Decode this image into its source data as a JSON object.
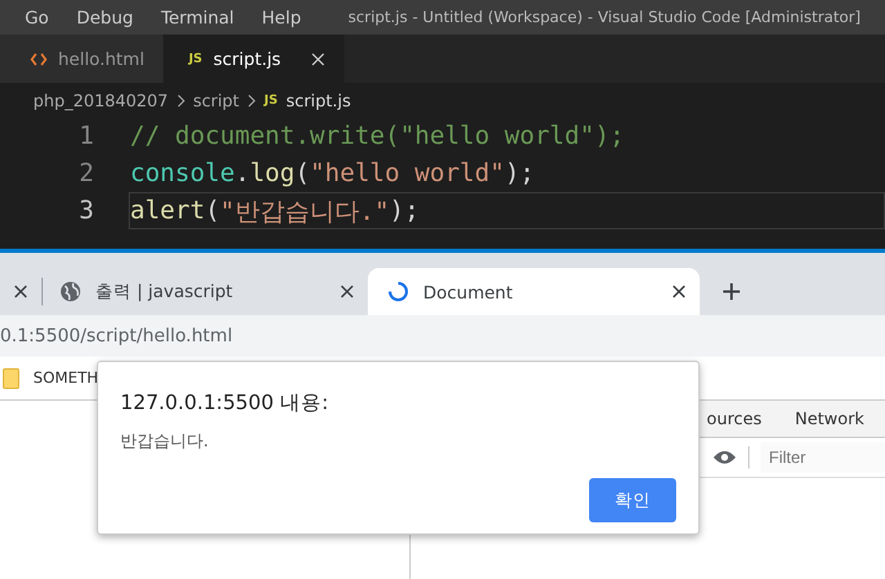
{
  "vscode": {
    "menu": [
      "Go",
      "Debug",
      "Terminal",
      "Help"
    ],
    "title": "script.js - Untitled (Workspace) - Visual Studio Code [Administrator]",
    "tabs": [
      {
        "label": "hello.html",
        "kind": "html",
        "selected": false
      },
      {
        "label": "script.js",
        "kind": "js",
        "badge": "JS",
        "selected": true
      }
    ],
    "breadcrumb": [
      "php_201840207",
      "script",
      "script.js"
    ],
    "breadcrumb_badge": "JS",
    "lines": [
      {
        "number": "1",
        "current": false,
        "tokens": [
          {
            "kind": "comment",
            "text": "// document.write(\"hello world\");"
          }
        ]
      },
      {
        "number": "2",
        "current": false,
        "tokens": [
          {
            "kind": "type",
            "text": "console"
          },
          {
            "kind": "punct",
            "text": "."
          },
          {
            "kind": "func",
            "text": "log"
          },
          {
            "kind": "punct",
            "text": "("
          },
          {
            "kind": "string",
            "text": "\"hello world\""
          },
          {
            "kind": "punct",
            "text": ");"
          }
        ]
      },
      {
        "number": "3",
        "current": true,
        "tokens": [
          {
            "kind": "func",
            "text": "alert"
          },
          {
            "kind": "punct",
            "text": "("
          },
          {
            "kind": "string",
            "text": "\"반갑습니다.\""
          },
          {
            "kind": "punct",
            "text": ");"
          }
        ]
      }
    ]
  },
  "browser": {
    "tabs": [
      {
        "kind": "cut",
        "selected": false
      },
      {
        "label": "출력 | javascript",
        "kind": "globe",
        "selected": false
      },
      {
        "label": "Document",
        "kind": "loading",
        "selected": true
      }
    ],
    "address": "0.1:5500/script/hello.html",
    "bookmark": "SOMETH",
    "devtools": {
      "tabs": [
        "ources",
        "Network"
      ],
      "filter_placeholder": "Filter"
    }
  },
  "dialog": {
    "title": "127.0.0.1:5500 내용:",
    "message": "반갑습니다.",
    "button": "확인"
  }
}
